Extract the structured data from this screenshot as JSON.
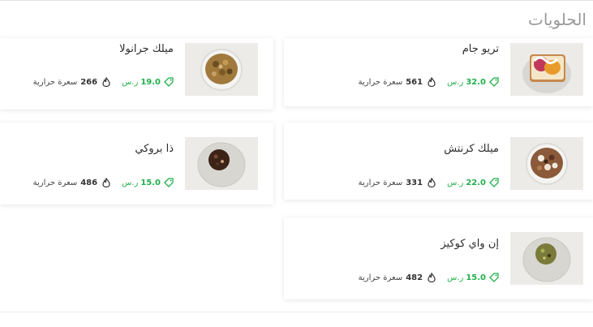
{
  "section": {
    "title": "الحلويات"
  },
  "products": [
    {
      "name": "تريو جام",
      "price": "32.0",
      "currency": "ر.س",
      "calories": "561",
      "calories_unit": "سعرة حرارية",
      "image": "toast-with-jam"
    },
    {
      "name": "ميلك جرانولا",
      "price": "19.0",
      "currency": "ر.س",
      "calories": "266",
      "calories_unit": "سعرة حرارية",
      "image": "granola-cup"
    },
    {
      "name": "ميلك كرنتش",
      "price": "22.0",
      "currency": "ر.س",
      "calories": "331",
      "calories_unit": "سعرة حرارية",
      "image": "crunch-cup"
    },
    {
      "name": "ذا بروكي",
      "price": "15.0",
      "currency": "ر.س",
      "calories": "486",
      "calories_unit": "سعرة حرارية",
      "image": "brookie-cookie"
    },
    {
      "name": "إن واي كوكيز",
      "price": "15.0",
      "currency": "ر.س",
      "calories": "482",
      "calories_unit": "سعرة حرارية",
      "image": "pistachio-cookie"
    }
  ],
  "colors": {
    "price": "#22b04b",
    "title": "#9a9a9a"
  }
}
